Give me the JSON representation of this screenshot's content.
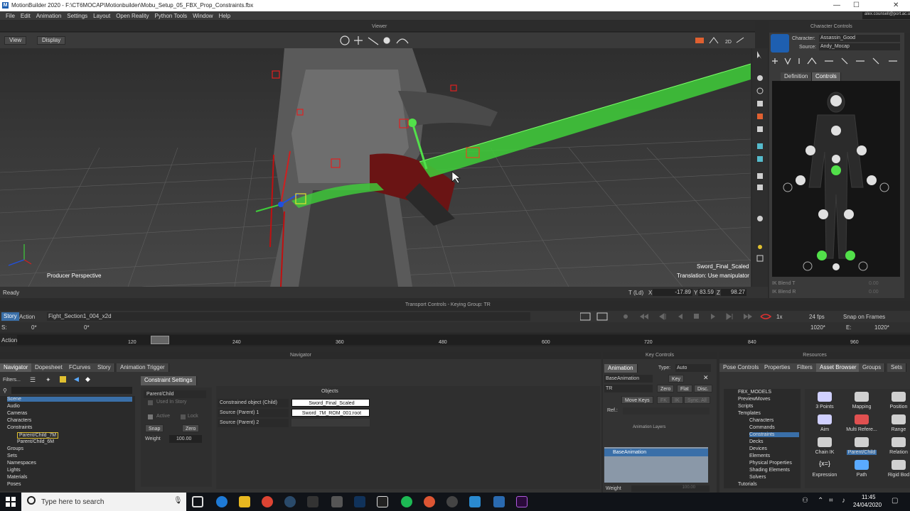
{
  "window": {
    "app_name": "MotionBuilder 2020",
    "separator": "-",
    "file_path": "F:\\CT6MOCAP\\Motionbuilder\\Mobu_Setup_05_FBX_Prop_Constraints.fbx",
    "min": "—",
    "max": "☐",
    "close": "✕",
    "user": "alex.counsell@port.ac.uk"
  },
  "menu": [
    "File",
    "Edit",
    "Animation",
    "Settings",
    "Layout",
    "Open Reality",
    "Python Tools",
    "Window",
    "Help"
  ],
  "viewer": {
    "title": "Viewer",
    "view_button": "View",
    "display_button": "Display",
    "camera_label": "Producer Perspective",
    "selected_object": "Sword_Final_Scaled",
    "manipulator_hint": "Translation: Use manipulator",
    "status": "Ready",
    "coord_label_t": "T (Ld)",
    "coord_x_label": "X",
    "coord_x": "-17.89",
    "coord_y_label": "Y",
    "coord_y": "83.59",
    "coord_z_label": "Z",
    "coord_z": "98.27"
  },
  "character_controls": {
    "title": "Character Controls",
    "character_label": "Character:",
    "character_value": "Assassin_Good",
    "source_label": "Source:",
    "source_value": "Andy_Mocap",
    "tab_definition": "Definition",
    "tab_controls": "Controls",
    "ik_blend_t": "IK Blend T",
    "ik_blend_r": "IK Blend R",
    "ik_t_value": "0.00",
    "ik_r_value": "0.00"
  },
  "transport": {
    "title": "Transport Controls  -  Keying Group: TR",
    "story_button": "Story",
    "action_button": "Action",
    "take_name": "Fight_Section1_004_x2d",
    "speed": "1x",
    "fps": "24 fps",
    "snap": "Snap on Frames",
    "start_label": "S:",
    "start_value": "0*",
    "start_value2": "0*",
    "end_value": "1020*",
    "end_label": "E:",
    "end_value2": "1020*",
    "action_label": "Action",
    "ticks": [
      "120",
      "240",
      "360",
      "480",
      "600",
      "720",
      "840",
      "960"
    ]
  },
  "navigator": {
    "title": "Navigator",
    "tabs": [
      "Navigator",
      "Dopesheet",
      "FCurves",
      "Story",
      "Animation Trigger"
    ],
    "filters_label": "Filters...",
    "tree": [
      {
        "label": "Scene",
        "depth": 0,
        "selected": true
      },
      {
        "label": "Audio",
        "depth": 0
      },
      {
        "label": "Cameras",
        "depth": 0
      },
      {
        "label": "Characters",
        "depth": 0
      },
      {
        "label": "Constraints",
        "depth": 0
      },
      {
        "label": "Parent/Child_7M",
        "depth": 1,
        "highlight": true
      },
      {
        "label": "Parent/Child_6M",
        "depth": 1
      },
      {
        "label": "Groups",
        "depth": 0
      },
      {
        "label": "Sets",
        "depth": 0
      },
      {
        "label": "Namespaces",
        "depth": 0
      },
      {
        "label": "Lights",
        "depth": 0
      },
      {
        "label": "Materials",
        "depth": 0
      },
      {
        "label": "Poses",
        "depth": 0
      }
    ],
    "constraint_settings_tab": "Constraint Settings",
    "constraint_name": "Parent/Child",
    "used_in_story": "Used In Story",
    "active": "Active",
    "lock": "Lock",
    "snap": "Snap",
    "zero": "Zero",
    "weight_label": "Weight",
    "weight_value": "100.00",
    "objects_header": "Objects",
    "rows": [
      {
        "label": "Constrained object (Child)",
        "value": "Sword_Final_Scaled"
      },
      {
        "label": "Source (Parent) 1",
        "value": "Sword_7M_ROM_001:root"
      },
      {
        "label": "Source (Parent) 2",
        "value": ""
      }
    ]
  },
  "key_controls": {
    "title": "Key Controls",
    "animation": "Animation",
    "type_label": "Type:",
    "type_value": "Auto",
    "base_animation": "BaseAnimation",
    "key": "Key",
    "tr": "TR",
    "zero": "Zero",
    "flat": "Flat",
    "disc": "Disc.",
    "move_keys": "Move Keys",
    "fk": "FK",
    "ik": "IK",
    "sync_all": "Sync. All",
    "ref_label": "Ref.:",
    "layers_title": "Animation Layers",
    "layer_name": "BaseAnimation",
    "weight_label": "Weight",
    "weight_value": "100.00"
  },
  "resources": {
    "title": "Resources",
    "tabs": [
      "Pose Controls",
      "Properties",
      "Filters",
      "Asset Browser",
      "Groups",
      "Sets"
    ],
    "active_tab": "Asset Browser",
    "tree": [
      {
        "label": "FBX_MODELS",
        "depth": 0
      },
      {
        "label": "PreviewMoves",
        "depth": 0
      },
      {
        "label": "Scripts",
        "depth": 0
      },
      {
        "label": "Templates",
        "depth": 0
      },
      {
        "label": "Characters",
        "depth": 1
      },
      {
        "label": "Commands",
        "depth": 1
      },
      {
        "label": "Constraints",
        "depth": 1,
        "selected": true
      },
      {
        "label": "Decks",
        "depth": 1
      },
      {
        "label": "Devices",
        "depth": 1
      },
      {
        "label": "Elements",
        "depth": 1
      },
      {
        "label": "Physical Properties",
        "depth": 1
      },
      {
        "label": "Shading Elements",
        "depth": 1
      },
      {
        "label": "Solvers",
        "depth": 1
      },
      {
        "label": "Tutorials",
        "depth": 0
      }
    ],
    "assets": [
      {
        "label": "3 Points"
      },
      {
        "label": "Mapping"
      },
      {
        "label": "Position"
      },
      {
        "label": "Aim"
      },
      {
        "label": "Multi Refere..."
      },
      {
        "label": "Range"
      },
      {
        "label": "Chain IK"
      },
      {
        "label": "Parent/Child",
        "selected": true
      },
      {
        "label": "Relation"
      },
      {
        "label": "Expression"
      },
      {
        "label": "Path"
      },
      {
        "label": "Rigid Bod"
      }
    ],
    "expression_glyph": "{x=}"
  },
  "taskbar": {
    "search_placeholder": "Type here to search",
    "time": "11:45",
    "date": "24/04/2020"
  },
  "colors": {
    "accent_blue": "#3a6fa8",
    "selection_green": "#52e04a",
    "taskbar": "#101318"
  }
}
